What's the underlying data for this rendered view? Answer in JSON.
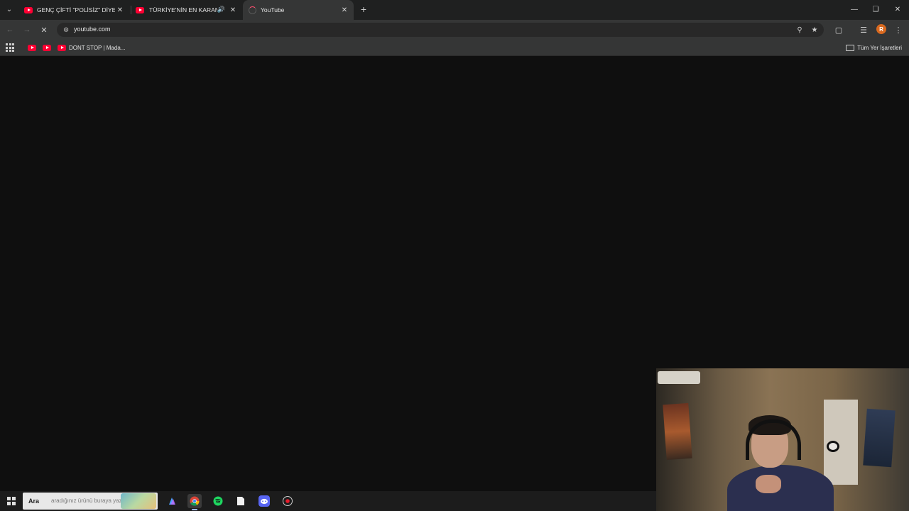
{
  "browser": {
    "tabs": [
      {
        "title": "GENÇ ÇİFTİ \"POLİSİZ\" DİYEREK",
        "favicon": "youtube-icon",
        "active": false,
        "audio": false
      },
      {
        "title": "TÜRKİYE'NİN EN KARANLIK",
        "favicon": "youtube-icon",
        "active": false,
        "audio": true
      },
      {
        "title": "YouTube",
        "favicon": "loading-spinner-icon",
        "active": true,
        "audio": false
      }
    ],
    "address": "youtube.com",
    "profile_initial": "R",
    "bookmarks": [
      {
        "label": "",
        "favicon": "youtube-icon"
      },
      {
        "label": "",
        "favicon": "youtube-icon"
      },
      {
        "label": "DONT STOP | Mada...",
        "favicon": "youtube-icon"
      }
    ],
    "all_bookmarks_label": "Tüm Yer İşaretleri"
  },
  "taskbar": {
    "search_label": "Ara",
    "search_hint": "aradığınız ürünü buraya yazın",
    "apps": [
      "copilot-icon",
      "chrome-icon",
      "spotify-icon",
      "file-icon",
      "discord-icon",
      "record-icon"
    ]
  },
  "colors": {
    "youtube_red": "#ff0033",
    "content_bg": "#0f0f0f",
    "toolbar_bg": "#353636",
    "tabstrip_bg": "#1f2020",
    "avatar": "#d9691f"
  }
}
